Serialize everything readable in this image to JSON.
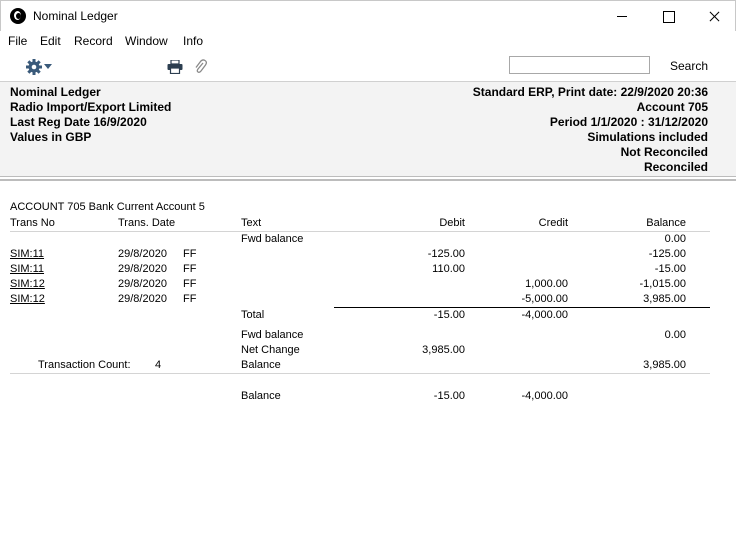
{
  "window": {
    "title": "Nominal Ledger"
  },
  "menu": [
    "File",
    "Edit",
    "Record",
    "Window",
    "Info"
  ],
  "toolbar": {
    "search_label": "Search",
    "search_value": ""
  },
  "header": {
    "left": [
      "Nominal Ledger",
      "Radio Import/Export Limited",
      "Last Reg Date  16/9/2020",
      "Values in GBP"
    ],
    "right": [
      "Standard ERP, Print date: 22/9/2020 20:36",
      "Account  705",
      "Period  1/1/2020 : 31/12/2020",
      "Simulations included",
      "Not Reconciled",
      "Reconciled"
    ]
  },
  "report": {
    "account_title": "ACCOUNT 705  Bank Current Account 5",
    "columns": {
      "trans_no": "Trans No",
      "trans_date": "Trans. Date",
      "text": "Text",
      "debit": "Debit",
      "credit": "Credit",
      "balance": "Balance"
    },
    "fwd_balance": {
      "text": "Fwd balance",
      "balance": "0.00"
    },
    "rows": [
      {
        "trans_no": "SIM:11",
        "date": "29/8/2020",
        "code": "FF",
        "debit": "-125.00",
        "credit": "",
        "balance": "-125.00"
      },
      {
        "trans_no": "SIM:11",
        "date": "29/8/2020",
        "code": "FF",
        "debit": "110.00",
        "credit": "",
        "balance": "-15.00"
      },
      {
        "trans_no": "SIM:12",
        "date": "29/8/2020",
        "code": "FF",
        "debit": "",
        "credit": "1,000.00",
        "balance": "-1,015.00"
      },
      {
        "trans_no": "SIM:12",
        "date": "29/8/2020",
        "code": "FF",
        "debit": "",
        "credit": "-5,000.00",
        "balance": "3,985.00"
      }
    ],
    "total": {
      "label": "Total",
      "debit": "-15.00",
      "credit": "-4,000.00"
    },
    "summary": {
      "fwd_label": "Fwd balance",
      "fwd_balance": "0.00",
      "net_label": "Net Change",
      "net_value": "3,985.00",
      "count_label": "Transaction Count:",
      "count_value": "4",
      "balance_label": "Balance",
      "balance_value": "3,985.00"
    },
    "grand": {
      "label": "Balance",
      "debit": "-15.00",
      "credit": "-4,000.00"
    }
  }
}
